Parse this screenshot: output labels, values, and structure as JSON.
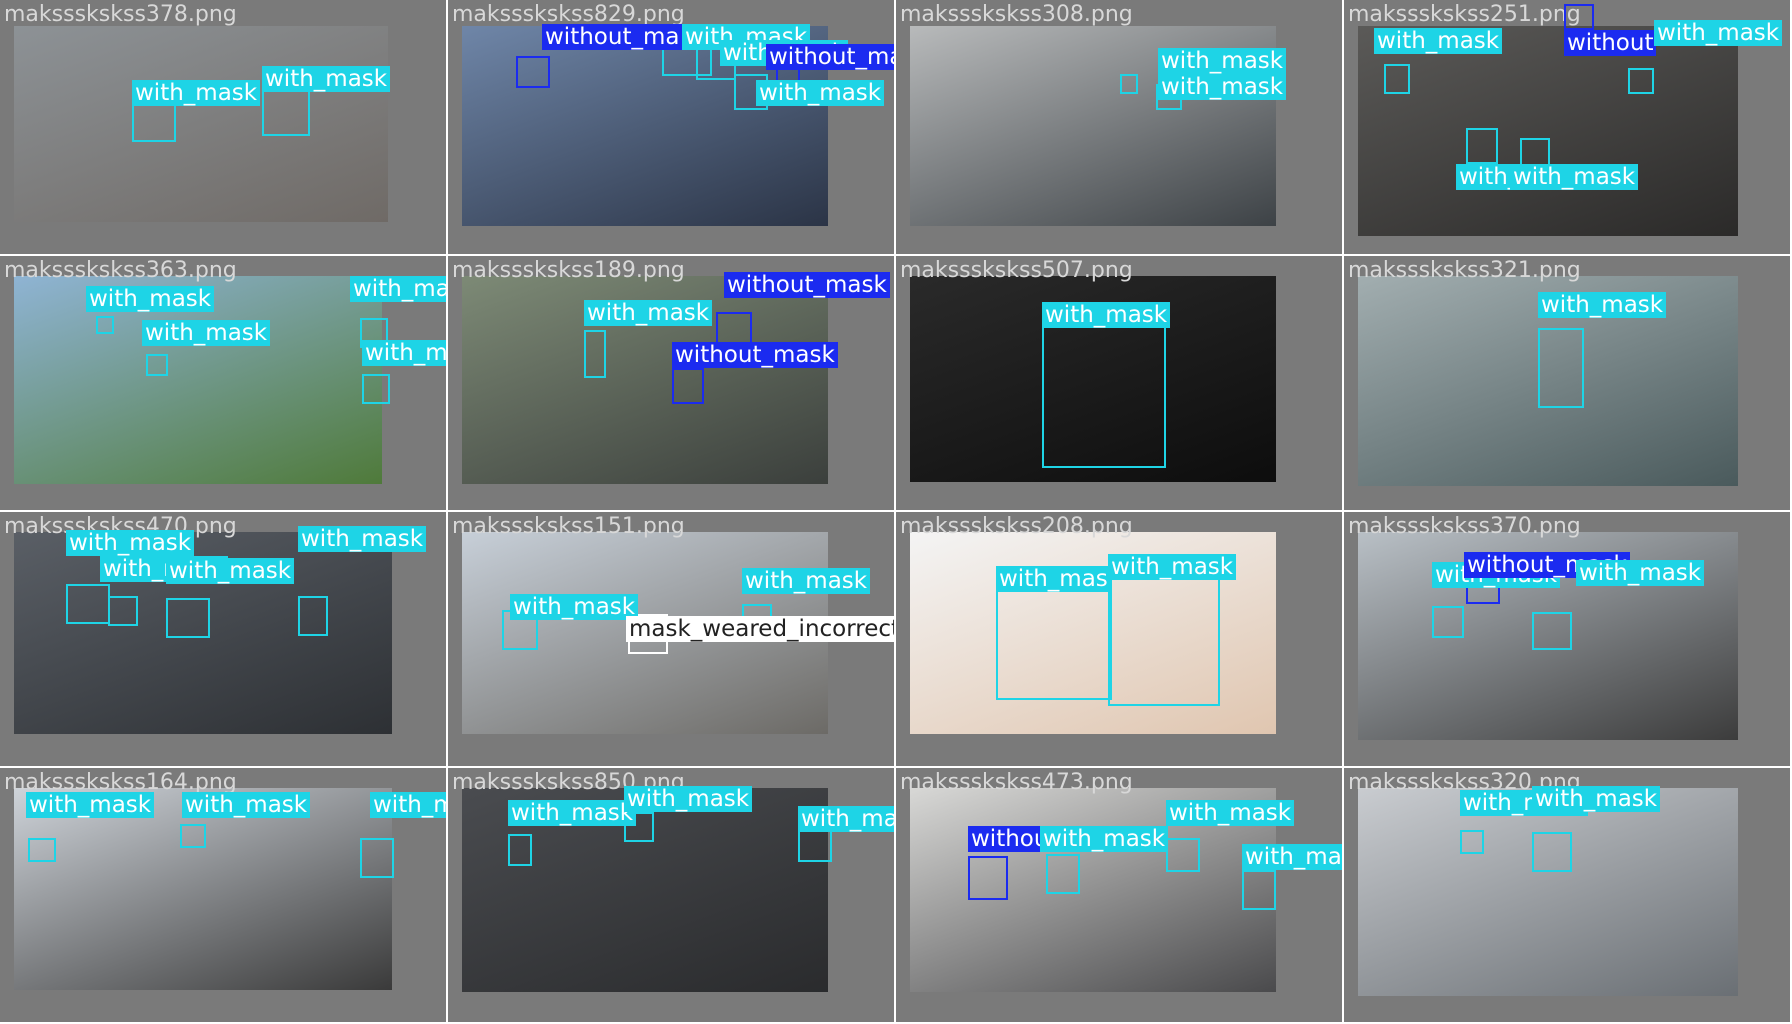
{
  "palette": {
    "with_mask": "#1ed4e6",
    "without_mask": "#1b2bf0",
    "mask_weared_incorrect": "#ffffff",
    "tile_background": "#7a7a7a",
    "filename_text": "#d8d8d8"
  },
  "tiles": [
    {
      "filename": "makssskskss378.png",
      "scene_colors": [
        "#8d9296",
        "#6f6a66"
      ],
      "detections": [
        {
          "cls": "with_mask",
          "text": "with_mask"
        },
        {
          "cls": "with_mask",
          "text": "with_mask"
        }
      ]
    },
    {
      "filename": "makssskskss829.png",
      "scene_colors": [
        "#6f86a8",
        "#2b3446"
      ],
      "detections": [
        {
          "cls": "without_mask",
          "text": "without_ma"
        },
        {
          "cls": "with_mask",
          "text": "with_mask"
        },
        {
          "cls": "with_mask",
          "text": "with_mask"
        },
        {
          "cls": "without_mask",
          "text": "without_mask"
        },
        {
          "cls": "with_mask",
          "text": "with_mask"
        }
      ]
    },
    {
      "filename": "makssskskss308.png",
      "scene_colors": [
        "#b8babb",
        "#3d4246"
      ],
      "detections": [
        {
          "cls": "with_mask",
          "text": "with_mask"
        },
        {
          "cls": "with_mask",
          "text": "with_mask"
        }
      ]
    },
    {
      "filename": "makssskskss251.png",
      "scene_colors": [
        "#5b5a58",
        "#2b2a29"
      ],
      "detections": [
        {
          "cls": "with_mask",
          "text": "with_mask"
        },
        {
          "cls": "without_mask",
          "text": "without"
        },
        {
          "cls": "with_mask",
          "text": "with_mask"
        },
        {
          "cls": "with_mask",
          "text": "with_mask"
        },
        {
          "cls": "with_mask",
          "text": "with_mask"
        }
      ]
    },
    {
      "filename": "makssskskss363.png",
      "scene_colors": [
        "#8fb4d4",
        "#4f7a3a"
      ],
      "detections": [
        {
          "cls": "with_mask",
          "text": "with_mask"
        },
        {
          "cls": "with_mask",
          "text": "with_mask"
        },
        {
          "cls": "with_mask",
          "text": "with_mask"
        },
        {
          "cls": "with_mask",
          "text": "with_mask"
        }
      ]
    },
    {
      "filename": "makssskskss189.png",
      "scene_colors": [
        "#7d8a76",
        "#3b3f3c"
      ],
      "detections": [
        {
          "cls": "with_mask",
          "text": "with_mask"
        },
        {
          "cls": "without_mask",
          "text": "without_mask"
        },
        {
          "cls": "without_mask",
          "text": "without_mask"
        }
      ]
    },
    {
      "filename": "makssskskss507.png",
      "scene_colors": [
        "#2a2a2a",
        "#0d0d0d"
      ],
      "detections": [
        {
          "cls": "with_mask",
          "text": "with_mask"
        }
      ]
    },
    {
      "filename": "makssskskss321.png",
      "scene_colors": [
        "#a2aeb0",
        "#4a5a5c"
      ],
      "detections": [
        {
          "cls": "with_mask",
          "text": "with_mask"
        }
      ]
    },
    {
      "filename": "makssskskss470.png",
      "scene_colors": [
        "#5a5f66",
        "#2d3034"
      ],
      "detections": [
        {
          "cls": "with_mask",
          "text": "with_mask"
        },
        {
          "cls": "with_mask",
          "text": "with_mask"
        },
        {
          "cls": "with_mask",
          "text": "with_mask"
        },
        {
          "cls": "with_mask",
          "text": "with_mask"
        }
      ]
    },
    {
      "filename": "makssskskss151.png",
      "scene_colors": [
        "#c7cfd8",
        "#6c6a66"
      ],
      "detections": [
        {
          "cls": "with_mask",
          "text": "with_mask"
        },
        {
          "cls": "with_mask",
          "text": "with_mask"
        },
        {
          "cls": "mask_weared_incorrect",
          "text": "mask_weared_incorrect"
        }
      ]
    },
    {
      "filename": "makssskskss208.png",
      "scene_colors": [
        "#f4f4f4",
        "#e0c6b0"
      ],
      "detections": [
        {
          "cls": "with_mask",
          "text": "with_mas"
        },
        {
          "cls": "with_mask",
          "text": "with_mask"
        }
      ]
    },
    {
      "filename": "makssskskss370.png",
      "scene_colors": [
        "#b9c0c6",
        "#3c3c3c"
      ],
      "detections": [
        {
          "cls": "with_mask",
          "text": "with_mask"
        },
        {
          "cls": "without_mask",
          "text": "without_mask"
        },
        {
          "cls": "with_mask",
          "text": "with_mask"
        }
      ]
    },
    {
      "filename": "makssskskss164.png",
      "scene_colors": [
        "#cfd4da",
        "#3a3a3a"
      ],
      "detections": [
        {
          "cls": "with_mask",
          "text": "with_mask"
        },
        {
          "cls": "with_mask",
          "text": "with_mask"
        },
        {
          "cls": "with_mask",
          "text": "with_mask"
        }
      ]
    },
    {
      "filename": "makssskskss850.png",
      "scene_colors": [
        "#4a4c50",
        "#2a2b2d"
      ],
      "detections": [
        {
          "cls": "with_mask",
          "text": "with_mask"
        },
        {
          "cls": "with_mask",
          "text": "with_mask"
        },
        {
          "cls": "with_mask",
          "text": "with_mask"
        }
      ]
    },
    {
      "filename": "makssskskss473.png",
      "scene_colors": [
        "#d8d8d6",
        "#4a4a4c"
      ],
      "detections": [
        {
          "cls": "with_mask",
          "text": "with_mask"
        },
        {
          "cls": "with_mask",
          "text": "with_mask"
        },
        {
          "cls": "without_mask",
          "text": "without_mask"
        },
        {
          "cls": "with_mask",
          "text": "with_mask"
        }
      ]
    },
    {
      "filename": "makssskskss320.png",
      "scene_colors": [
        "#c9ccd0",
        "#6a6f74"
      ],
      "detections": [
        {
          "cls": "with_mask",
          "text": "with_mask"
        },
        {
          "cls": "with_mask",
          "text": "with_mask"
        }
      ]
    }
  ]
}
